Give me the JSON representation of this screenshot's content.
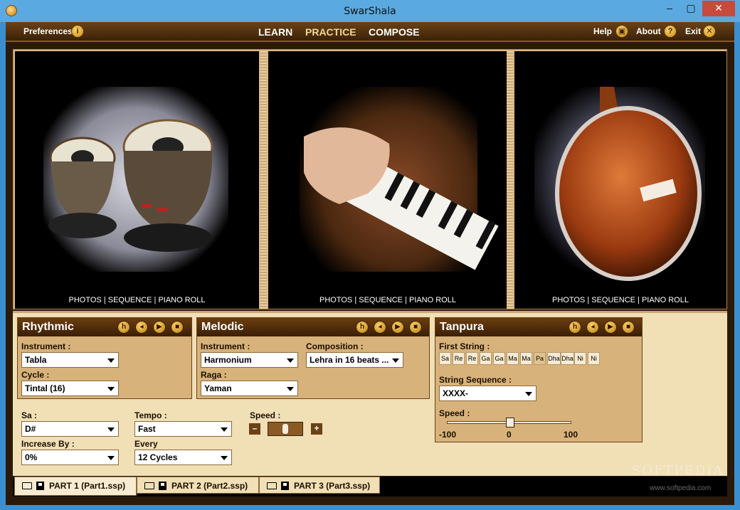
{
  "window": {
    "title": "SwarShala",
    "min": "–",
    "max": "▢",
    "close": "✕"
  },
  "menubar": {
    "preferences": "Preferences",
    "nav": [
      "LEARN",
      "PRACTICE",
      "COMPOSE"
    ],
    "help": "Help",
    "about": "About",
    "exit": "Exit"
  },
  "photos": {
    "caption": "PHOTOS | SEQUENCE | PIANO ROLL",
    "items": [
      "tabla",
      "harmonium",
      "tanpura"
    ]
  },
  "rhythmic": {
    "title": "Rhythmic",
    "instrument_label": "Instrument :",
    "instrument_value": "Tabla",
    "cycle_label": "Cycle :",
    "cycle_value": "Tintal (16)"
  },
  "melodic": {
    "title": "Melodic",
    "instrument_label": "Instrument :",
    "instrument_value": "Harmonium",
    "composition_label": "Composition :",
    "composition_value": "Lehra in 16 beats ...",
    "raga_label": "Raga :",
    "raga_value": "Yaman"
  },
  "settings": {
    "sa_label": "Sa :",
    "sa_value": "D#",
    "tempo_label": "Tempo :",
    "tempo_value": "Fast",
    "speed_label": "Speed :",
    "increase_label": "Increase By :",
    "increase_value": "0%",
    "every_label": "Every",
    "every_value": "12 Cycles"
  },
  "tanpura": {
    "title": "Tanpura",
    "first_string_label": "First String :",
    "notes": [
      "Sa",
      "Re",
      "Re",
      "Ga",
      "Ga",
      "Ma",
      "Ma",
      "Pa",
      "Dha",
      "Dha",
      "Ni",
      "Ni"
    ],
    "selected_note_index": 7,
    "sequence_label": "String Sequence :",
    "sequence_value": "XXXX-",
    "speed_label": "Speed :",
    "speed_min": "-100",
    "speed_mid": "0",
    "speed_max": "100",
    "speed_value": 0
  },
  "tabs": [
    {
      "label": "PART 1 (Part1.ssp)"
    },
    {
      "label": "PART 2 (Part2.ssp)"
    },
    {
      "label": "PART 3 (Part3.ssp)"
    }
  ],
  "watermark": "SOFTPEDIA",
  "watermark_url": "www.softpedia.com",
  "colors": {
    "accent": "#6b4216",
    "panel": "#f1dfb6",
    "box": "#d8b27b"
  }
}
